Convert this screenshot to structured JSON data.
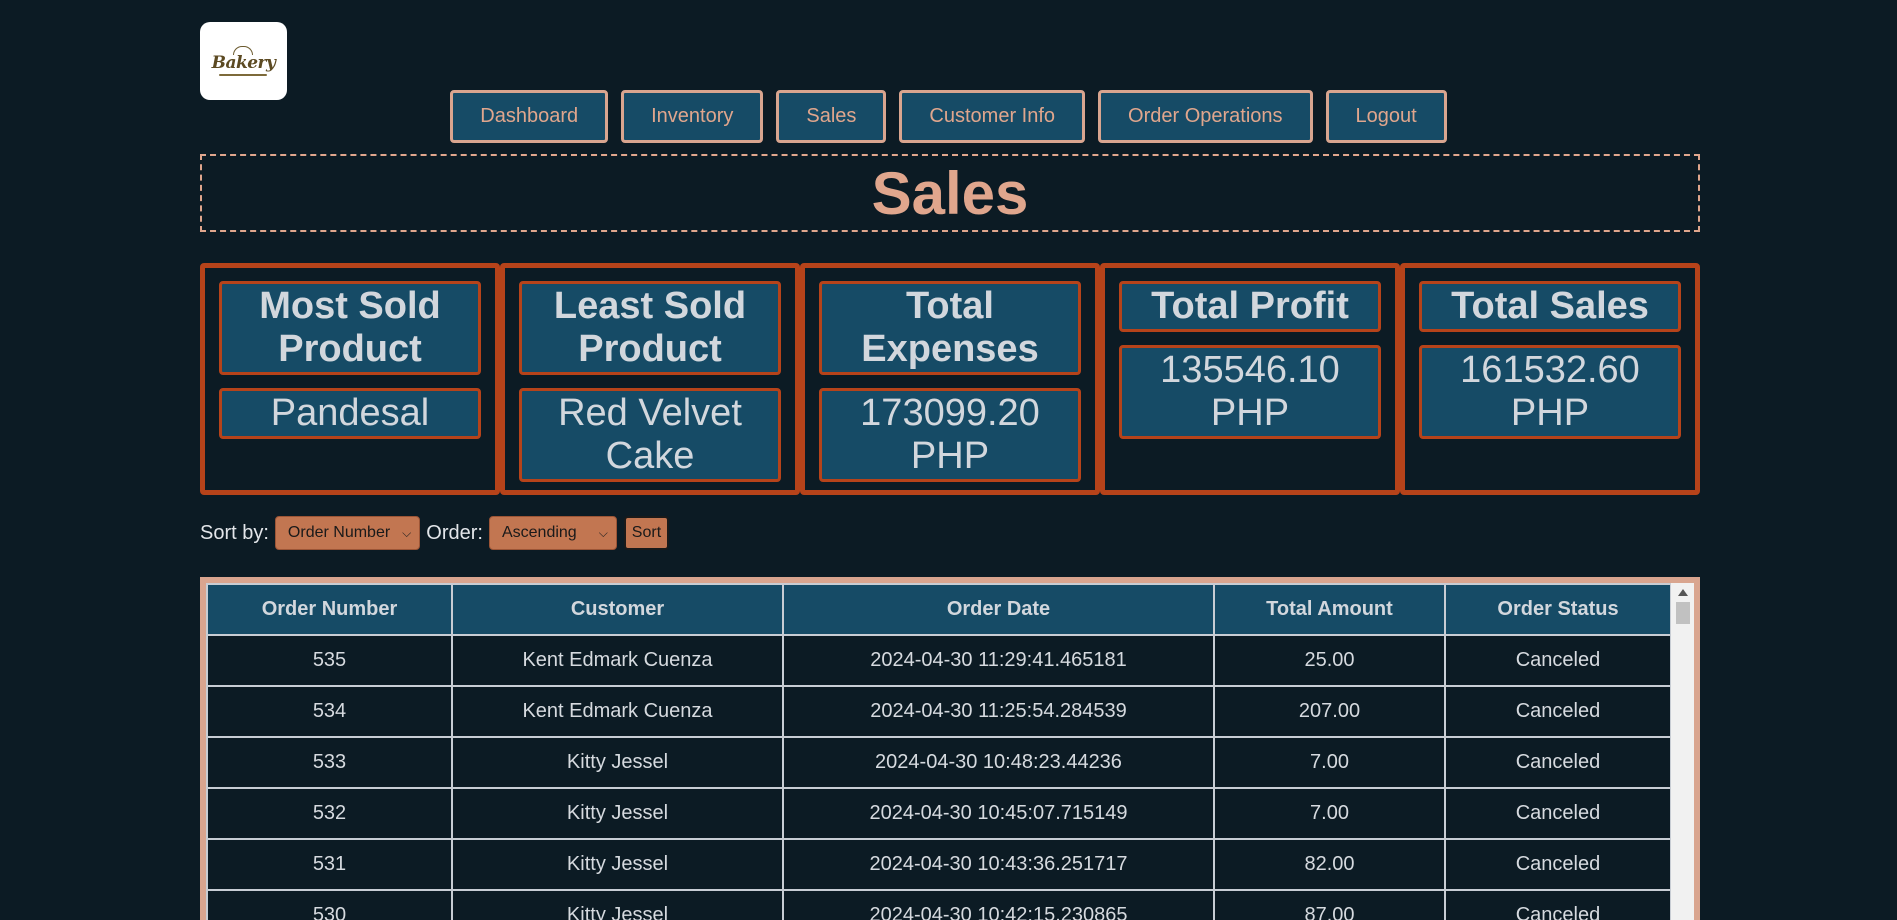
{
  "logo": {
    "text": "Bakery"
  },
  "nav": {
    "items": [
      "Dashboard",
      "Inventory",
      "Sales",
      "Customer Info",
      "Order Operations",
      "Logout"
    ]
  },
  "page": {
    "title": "Sales"
  },
  "cards": [
    {
      "label": "Most Sold Product",
      "value": "Pandesal"
    },
    {
      "label": "Least Sold Product",
      "value": "Red Velvet Cake"
    },
    {
      "label": "Total Expenses",
      "value": "173099.20 PHP"
    },
    {
      "label": "Total Profit",
      "value": "135546.10 PHP"
    },
    {
      "label": "Total Sales",
      "value": "161532.60 PHP"
    }
  ],
  "sort": {
    "sort_by_label": "Sort by:",
    "sort_by_value": "Order Number",
    "order_label": "Order:",
    "order_value": "Ascending",
    "button_label": "Sort"
  },
  "table": {
    "columns": [
      "Order Number",
      "Customer",
      "Order Date",
      "Total Amount",
      "Order Status"
    ],
    "rows": [
      [
        "535",
        "Kent Edmark Cuenza",
        "2024-04-30 11:29:41.465181",
        "25.00",
        "Canceled"
      ],
      [
        "534",
        "Kent Edmark Cuenza",
        "2024-04-30 11:25:54.284539",
        "207.00",
        "Canceled"
      ],
      [
        "533",
        "Kitty Jessel",
        "2024-04-30 10:48:23.44236",
        "7.00",
        "Canceled"
      ],
      [
        "532",
        "Kitty Jessel",
        "2024-04-30 10:45:07.715149",
        "7.00",
        "Canceled"
      ],
      [
        "531",
        "Kitty Jessel",
        "2024-04-30 10:43:36.251717",
        "82.00",
        "Canceled"
      ],
      [
        "530",
        "Kitty Jessel",
        "2024-04-30 10:42:15.230865",
        "87.00",
        "Canceled"
      ]
    ]
  }
}
